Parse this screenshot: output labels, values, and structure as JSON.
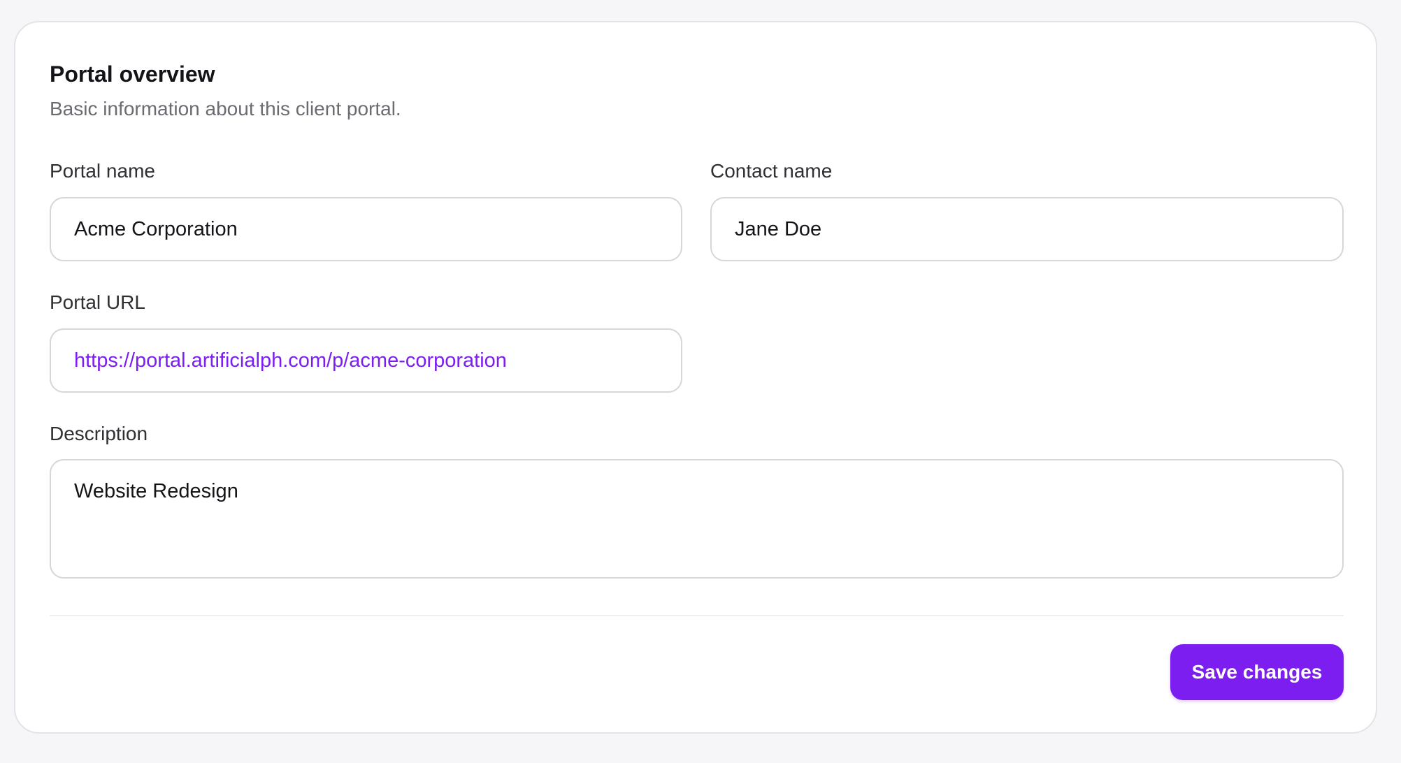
{
  "section": {
    "title": "Portal overview",
    "subtitle": "Basic information about this client portal."
  },
  "fields": {
    "portal_name": {
      "label": "Portal name",
      "value": "Acme Corporation"
    },
    "contact_name": {
      "label": "Contact name",
      "value": "Jane Doe"
    },
    "portal_url": {
      "label": "Portal URL",
      "value": "https://portal.artificialph.com/p/acme-corporation"
    },
    "description": {
      "label": "Description",
      "value": "Website Redesign"
    }
  },
  "actions": {
    "save_label": "Save changes"
  },
  "colors": {
    "accent": "#7c1ef0",
    "background": "#f6f6f8",
    "card": "#ffffff"
  }
}
